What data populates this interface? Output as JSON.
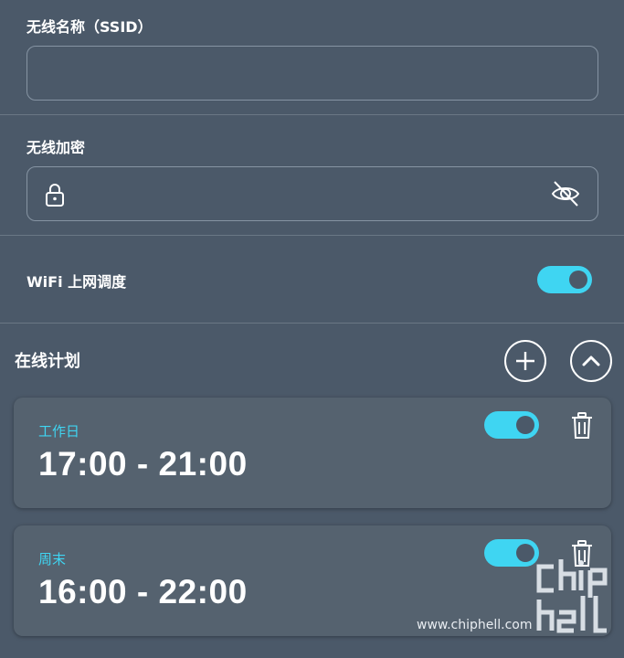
{
  "ssid": {
    "label": "无线名称（SSID）",
    "value": "",
    "placeholder": ""
  },
  "password": {
    "label": "无线加密",
    "value": "",
    "placeholder": ""
  },
  "wifi_schedule": {
    "label": "WiFi 上网调度",
    "enabled": true
  },
  "online_plan": {
    "title": "在线计划",
    "items": [
      {
        "label": "工作日",
        "time": "17:00 - 21:00",
        "enabled": true
      },
      {
        "label": "周末",
        "time": "16:00 - 22:00",
        "enabled": true
      }
    ]
  },
  "watermark": {
    "url_text": "www.chiphell.com",
    "logo_text": "chip hell"
  },
  "colors": {
    "background": "#4b5969",
    "card": "#55626f",
    "accent": "#3fd5f2",
    "border": "#8694a3"
  },
  "icons": {
    "password_lock": "lock-icon",
    "password_visibility": "eye-slash-icon",
    "add": "plus-icon",
    "collapse": "chevron-up-icon",
    "delete": "trash-icon"
  }
}
